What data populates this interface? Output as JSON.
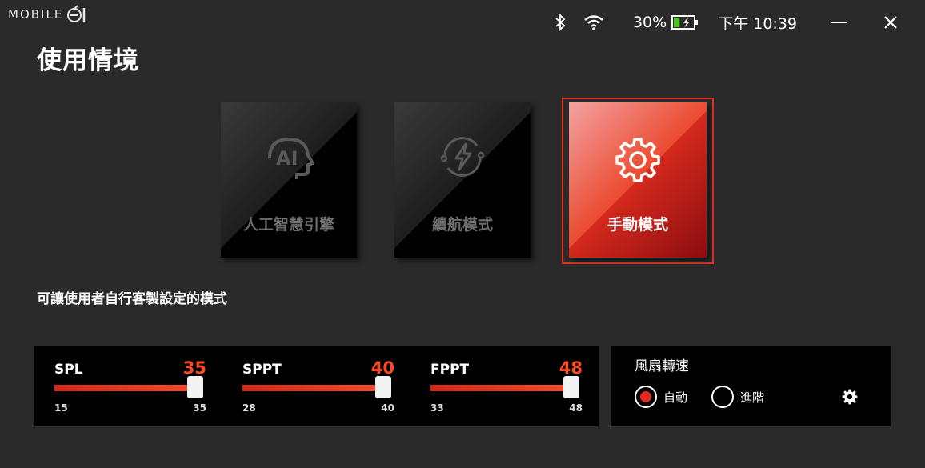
{
  "app": {
    "logo_text": "MOBILE"
  },
  "status": {
    "battery_percent": "30%",
    "battery_level": 0.3,
    "time": "下午 10:39",
    "icons": [
      "bluetooth-icon",
      "wifi-icon",
      "battery-charging-icon",
      "minimize-icon",
      "close-icon"
    ]
  },
  "page": {
    "title": "使用情境",
    "description": "可讓使用者自行客製設定的模式"
  },
  "modes": [
    {
      "label": "人工智慧引擎",
      "icon": "ai-head-icon",
      "selected": false
    },
    {
      "label": "續航模式",
      "icon": "battery-saver-icon",
      "selected": false
    },
    {
      "label": "手動模式",
      "icon": "gear-icon",
      "selected": true
    }
  ],
  "sliders": {
    "spl": {
      "name": "SPL",
      "value": 35,
      "min": 15,
      "max": 35
    },
    "sppt": {
      "name": "SPPT",
      "value": 40,
      "min": 28,
      "max": 40
    },
    "fppt": {
      "name": "FPPT",
      "value": 48,
      "min": 33,
      "max": 48
    }
  },
  "fan": {
    "title": "風扇轉速",
    "options": [
      {
        "label": "自動",
        "selected": true
      },
      {
        "label": "進階",
        "selected": false
      }
    ],
    "settings_icon": "gear-icon"
  },
  "colors": {
    "accent": "#ff4a23",
    "background": "#2a2a2a",
    "panel": "#000000",
    "battery_fill": "#4cc61e"
  }
}
